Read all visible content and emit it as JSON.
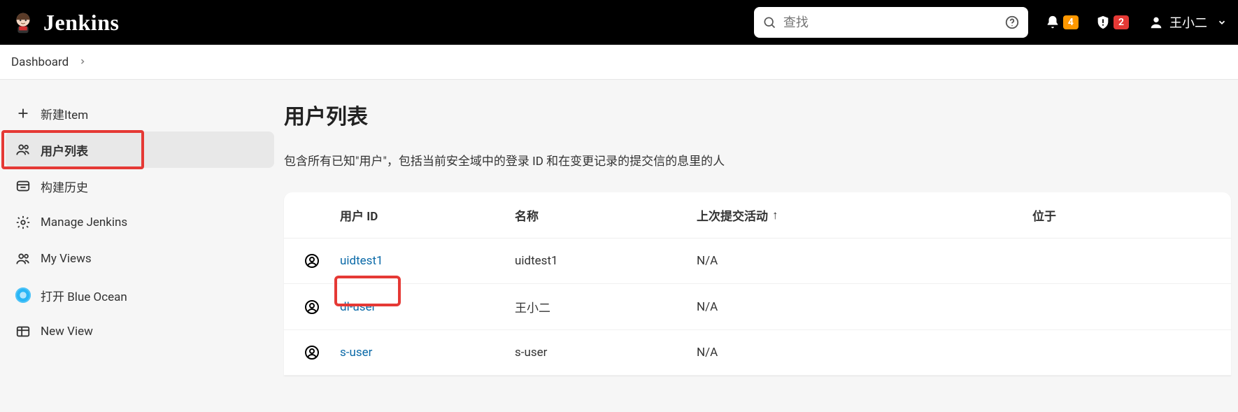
{
  "header": {
    "brand": "Jenkins",
    "search_placeholder": "查找",
    "notif_count": "4",
    "alert_count": "2",
    "username": "王小二"
  },
  "breadcrumbs": {
    "items": [
      "Dashboard"
    ]
  },
  "sidebar": {
    "items": [
      {
        "label": "新建Item"
      },
      {
        "label": "用户列表"
      },
      {
        "label": "构建历史"
      },
      {
        "label": "Manage Jenkins"
      },
      {
        "label": "My Views"
      },
      {
        "label": "打开 Blue Ocean"
      },
      {
        "label": "New View"
      }
    ]
  },
  "main": {
    "title": "用户列表",
    "description": "包含所有已知\"用户\"，包括当前安全域中的登录 ID 和在变更记录的提交信的息里的人",
    "columns": {
      "uid": "用户 ID",
      "name": "名称",
      "activity": "上次提交活动",
      "sort_arrow": "↑",
      "on": "位于"
    },
    "rows": [
      {
        "uid": "uidtest1",
        "name": "uidtest1",
        "activity": "N/A",
        "on": ""
      },
      {
        "uid": "dl-user",
        "name": "王小二",
        "activity": "N/A",
        "on": ""
      },
      {
        "uid": "s-user",
        "name": "s-user",
        "activity": "N/A",
        "on": ""
      }
    ]
  }
}
